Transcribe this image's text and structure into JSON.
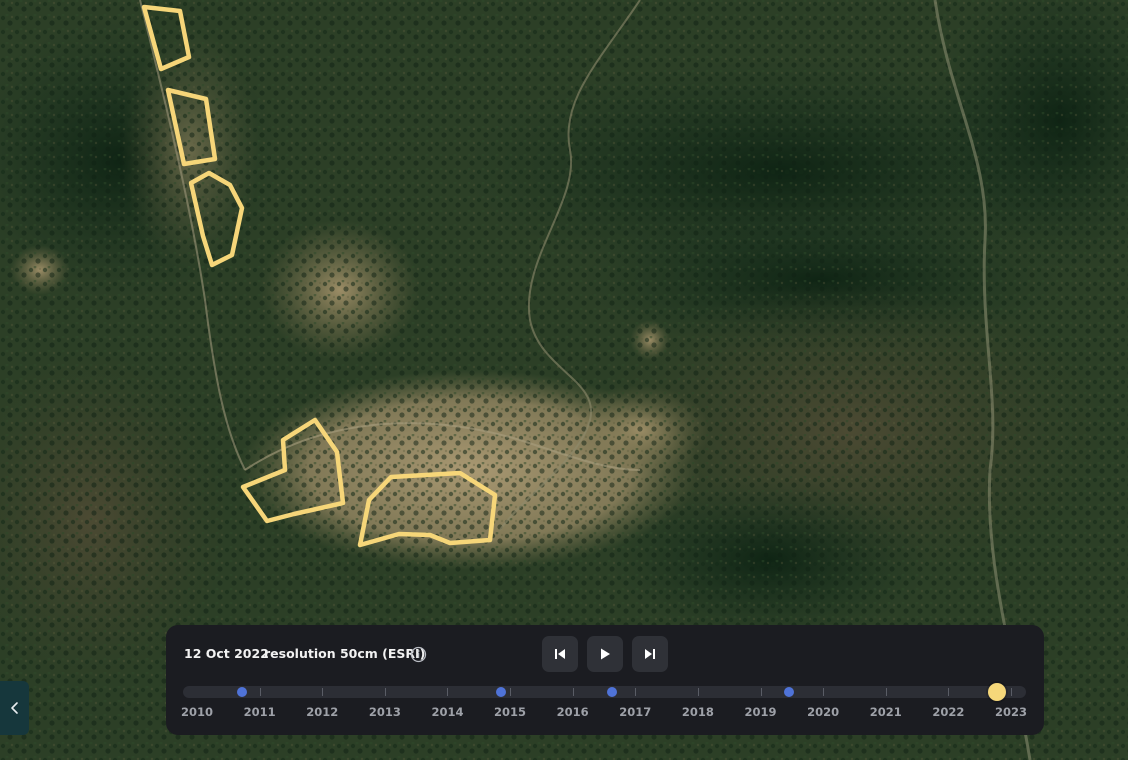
{
  "map": {
    "imagery": "satellite-forest-imagery",
    "polygon_color": "#f6d679"
  },
  "sidebar_toggle": {
    "icon": "chevron-left-icon"
  },
  "timeline": {
    "date": "12 Oct 2022",
    "resolution": "resolution 50cm (ESRI)",
    "info_icon": "info-icon",
    "controls": {
      "previous": "skip-previous-icon",
      "play": "play-icon",
      "next": "skip-next-icon"
    },
    "years": [
      "2010",
      "2011",
      "2012",
      "2013",
      "2014",
      "2015",
      "2016",
      "2017",
      "2018",
      "2019",
      "2020",
      "2021",
      "2022",
      "2023"
    ],
    "available_dates": [
      2010.72,
      2014.85,
      2016.62,
      2019.45
    ],
    "current": 2022.78,
    "start_year": 2010,
    "end_year": 2023,
    "accent_color": "#f5d77a",
    "dot_color": "#4f73d8"
  }
}
